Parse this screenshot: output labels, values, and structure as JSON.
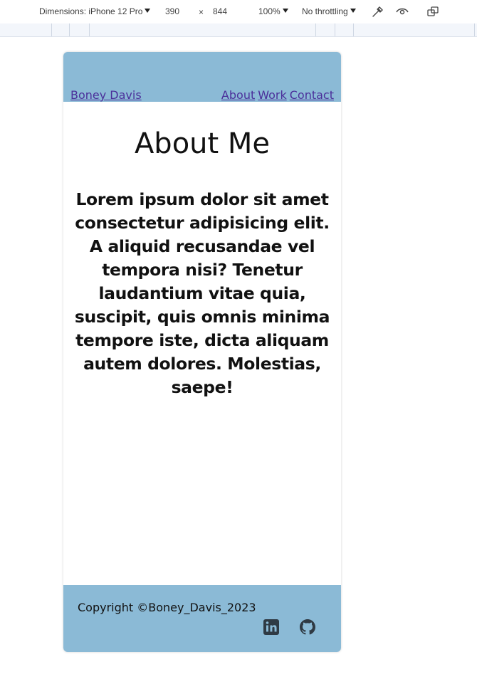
{
  "devtools": {
    "dimensions_label": "Dimensions: iPhone 12 Pro",
    "width_value": "390",
    "times_sign": "×",
    "height_value": "844",
    "zoom": "100%",
    "throttling": "No throttling",
    "icons": [
      "eyedropper-icon",
      "eye-icon",
      "rotate-icon"
    ]
  },
  "site": {
    "brand": "Boney Davis",
    "nav": [
      "About",
      "Work",
      "Contact"
    ],
    "title": "About Me",
    "paragraph": "Lorem ipsum dolor sit amet consectetur adipisicing elit. A aliquid recusandae vel tempora nisi? Tenetur laudantium vitae quia, suscipit, quis omnis minima tempore iste, dicta aliquam autem dolores. Molestias, saepe!",
    "copyright": "Copyright ©Boney_Davis_2023",
    "social_icons": [
      "linkedin-icon",
      "github-icon"
    ]
  },
  "colors": {
    "header_footer_bg": "#8bbad6",
    "link": "#4b2f9a"
  }
}
